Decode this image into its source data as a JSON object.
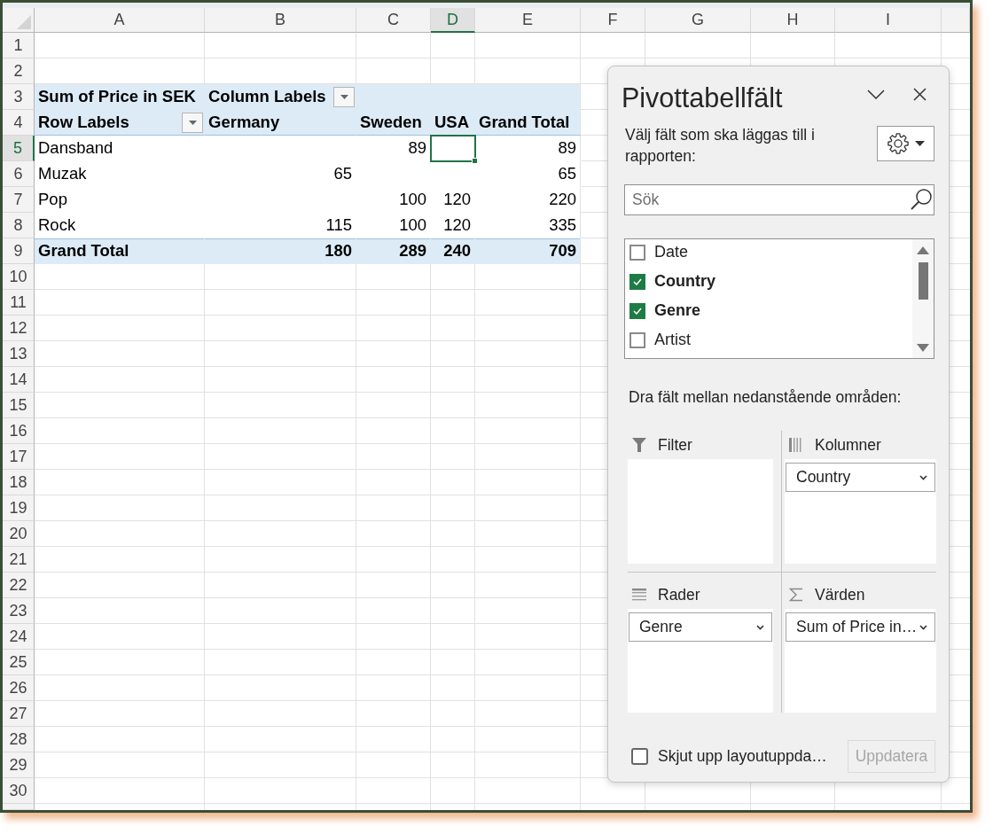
{
  "sheet": {
    "column_headers": [
      {
        "label": "A",
        "selected": false
      },
      {
        "label": "B",
        "selected": false
      },
      {
        "label": "C",
        "selected": false
      },
      {
        "label": "D",
        "selected": true
      },
      {
        "label": "E",
        "selected": false
      },
      {
        "label": "F",
        "selected": false
      },
      {
        "label": "G",
        "selected": false
      },
      {
        "label": "H",
        "selected": false
      },
      {
        "label": "I",
        "selected": false
      }
    ],
    "row_headers": [
      {
        "label": "1",
        "selected": false
      },
      {
        "label": "2",
        "selected": false
      },
      {
        "label": "3",
        "selected": false
      },
      {
        "label": "4",
        "selected": false
      },
      {
        "label": "5",
        "selected": true
      },
      {
        "label": "6",
        "selected": false
      },
      {
        "label": "7",
        "selected": false
      },
      {
        "label": "8",
        "selected": false
      },
      {
        "label": "9",
        "selected": false
      },
      {
        "label": "10",
        "selected": false
      },
      {
        "label": "11",
        "selected": false
      },
      {
        "label": "12",
        "selected": false
      },
      {
        "label": "13",
        "selected": false
      },
      {
        "label": "14",
        "selected": false
      },
      {
        "label": "15",
        "selected": false
      },
      {
        "label": "16",
        "selected": false
      },
      {
        "label": "17",
        "selected": false
      },
      {
        "label": "18",
        "selected": false
      },
      {
        "label": "19",
        "selected": false
      },
      {
        "label": "20",
        "selected": false
      },
      {
        "label": "21",
        "selected": false
      },
      {
        "label": "22",
        "selected": false
      },
      {
        "label": "23",
        "selected": false
      },
      {
        "label": "24",
        "selected": false
      },
      {
        "label": "25",
        "selected": false
      },
      {
        "label": "26",
        "selected": false
      },
      {
        "label": "27",
        "selected": false
      },
      {
        "label": "28",
        "selected": false
      },
      {
        "label": "29",
        "selected": false
      },
      {
        "label": "30",
        "selected": false
      }
    ],
    "pivot_table": {
      "rows": [
        {
          "kind": "header",
          "cells": [
            {
              "kind": "text",
              "text": "Sum of Price in SEK",
              "selected": false
            },
            {
              "kind": "label_filter",
              "text": "Column Labels",
              "selected": false
            },
            {
              "kind": "blank",
              "selected": false
            },
            {
              "kind": "blank",
              "selected": false
            },
            {
              "kind": "blank",
              "selected": false
            }
          ]
        },
        {
          "kind": "header",
          "cells": [
            {
              "kind": "label_filter",
              "text": "Row Labels",
              "selected": false
            },
            {
              "kind": "text",
              "text": "Germany",
              "selected": false
            },
            {
              "kind": "text",
              "text": "Sweden",
              "selected": false
            },
            {
              "kind": "text",
              "text": "USA",
              "selected": false
            },
            {
              "kind": "text",
              "text": "Grand Total",
              "selected": false
            }
          ]
        },
        {
          "kind": "data",
          "cells": [
            {
              "kind": "text",
              "text": "Dansband",
              "selected": false
            },
            {
              "kind": "blank",
              "selected": false
            },
            {
              "kind": "number",
              "text": "89",
              "selected": false
            },
            {
              "kind": "blank",
              "selected": true
            },
            {
              "kind": "number",
              "text": "89",
              "selected": false
            }
          ]
        },
        {
          "kind": "data",
          "cells": [
            {
              "kind": "text",
              "text": "Muzak",
              "selected": false
            },
            {
              "kind": "number",
              "text": "65",
              "selected": false
            },
            {
              "kind": "blank",
              "selected": false
            },
            {
              "kind": "blank",
              "selected": false
            },
            {
              "kind": "number",
              "text": "65",
              "selected": false
            }
          ]
        },
        {
          "kind": "data",
          "cells": [
            {
              "kind": "text",
              "text": "Pop",
              "selected": false
            },
            {
              "kind": "blank",
              "selected": false
            },
            {
              "kind": "number",
              "text": "100",
              "selected": false
            },
            {
              "kind": "number",
              "text": "120",
              "selected": false
            },
            {
              "kind": "number",
              "text": "220",
              "selected": false
            }
          ]
        },
        {
          "kind": "data",
          "cells": [
            {
              "kind": "text",
              "text": "Rock",
              "selected": false
            },
            {
              "kind": "number",
              "text": "115",
              "selected": false
            },
            {
              "kind": "number",
              "text": "100",
              "selected": false
            },
            {
              "kind": "number",
              "text": "120",
              "selected": false
            },
            {
              "kind": "number",
              "text": "335",
              "selected": false
            }
          ]
        },
        {
          "kind": "total",
          "cells": [
            {
              "kind": "text",
              "text": "Grand Total",
              "selected": false
            },
            {
              "kind": "number",
              "text": "180",
              "selected": false
            },
            {
              "kind": "number",
              "text": "289",
              "selected": false
            },
            {
              "kind": "number",
              "text": "240",
              "selected": false
            },
            {
              "kind": "number",
              "text": "709",
              "selected": false
            }
          ]
        }
      ]
    }
  },
  "pivot_panel": {
    "title": "Pivottabellfält",
    "instruction": "Välj fält som ska läggas till i rapporten:",
    "search": {
      "placeholder": "Sök"
    },
    "fields": [
      {
        "label": "Date",
        "checked": false
      },
      {
        "label": "Country",
        "checked": true
      },
      {
        "label": "Genre",
        "checked": true
      },
      {
        "label": "Artist",
        "checked": false
      }
    ],
    "areas_hint": "Dra fält mellan nedanstående områden:",
    "areas": [
      {
        "kind": "filter",
        "title": "Filter"
      },
      {
        "kind": "columns",
        "title": "Kolumner",
        "items": [
          "Country"
        ]
      },
      {
        "kind": "rows",
        "title": "Rader",
        "items": [
          "Genre"
        ]
      },
      {
        "kind": "values",
        "title": "Värden",
        "items": [
          "Sum of Price in…"
        ]
      }
    ],
    "defer": {
      "label": "Skjut upp layoutuppda…",
      "checked": false
    },
    "update_button": {
      "label": "Uppdatera",
      "disabled": true
    }
  }
}
